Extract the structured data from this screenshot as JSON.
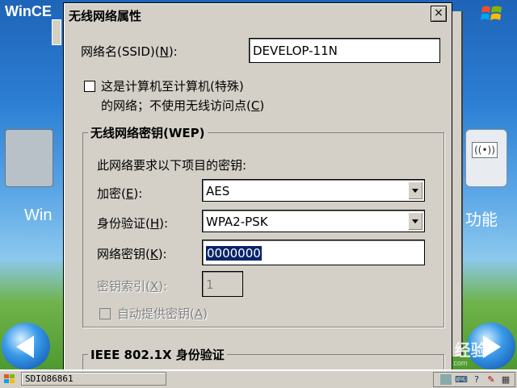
{
  "desktop": {
    "title": "WinCE",
    "left_caption": "Win",
    "right_caption": "功能",
    "wifi_label": "((•))"
  },
  "dialog": {
    "title": "无线网络属性",
    "close_label": "×",
    "ssid": {
      "label_pre": "网络名(SSID)(",
      "label_key": "N",
      "label_post": "):",
      "value": "DEVELOP-11N"
    },
    "adhoc": {
      "line1": "这是计算机至计算机(特殊)",
      "line2_pre": "的网络；不使用无线访问点(",
      "line2_key": "C",
      "line2_post": ")",
      "checked": false
    },
    "wep_group": {
      "title": "无线网络密钥(WEP)",
      "hint": "此网络要求以下项目的密钥:",
      "encryption": {
        "label_pre": "加密(",
        "label_key": "E",
        "label_post": "):",
        "value": "AES"
      },
      "auth": {
        "label_pre": "身份验证(",
        "label_key": "H",
        "label_post": "):",
        "value": "WPA2-PSK"
      },
      "key": {
        "label_pre": "网络密钥(",
        "label_key": "K",
        "label_post": "):",
        "value": "0000000"
      },
      "key_index": {
        "label_pre": "密钥索引(",
        "label_key": "X",
        "label_post": "):",
        "value": "1"
      },
      "auto_key": {
        "label_pre": "自动提供密钥(",
        "label_key": "A",
        "label_post": ")",
        "checked": false
      }
    },
    "ieee_group": {
      "title": "IEEE 802.1X 身份验证"
    }
  },
  "taskbar": {
    "task_label": "SDIO86861"
  },
  "watermark": {
    "text": "Bai百 经验",
    "sub": "jingyan.baidu.com"
  },
  "colors": {
    "dialog_bg": "#d4d0c8",
    "selection": "#0a246a",
    "desktop_sky": "#2c7fd4"
  }
}
